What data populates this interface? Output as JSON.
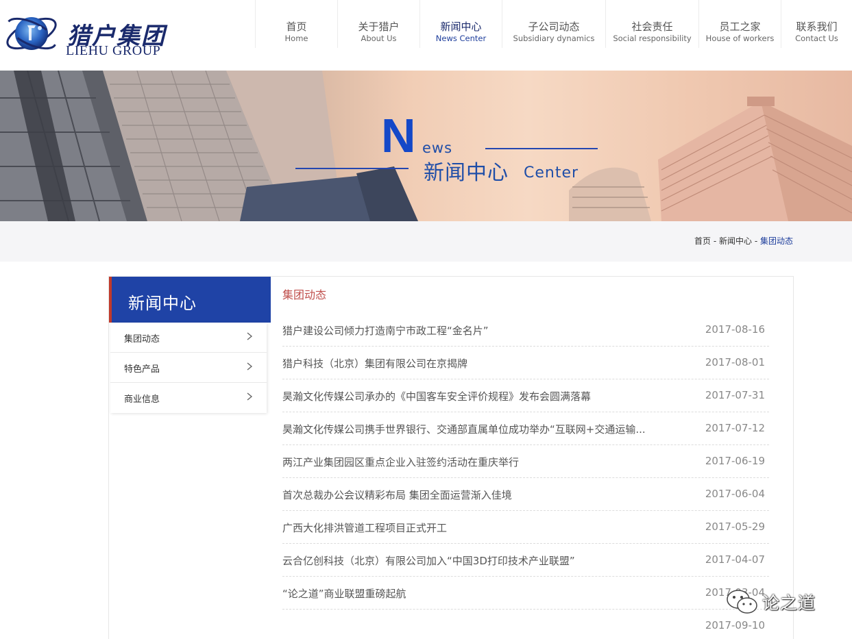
{
  "brand": {
    "name_cn": "猎户集团",
    "name_en": "LIEHU GROUP"
  },
  "nav": {
    "items": [
      {
        "cn": "首页",
        "en": "Home"
      },
      {
        "cn": "关于猎户",
        "en": "About Us"
      },
      {
        "cn": "新闻中心",
        "en": "News Center"
      },
      {
        "cn": "子公司动态",
        "en": "Subsidiary dynamics"
      },
      {
        "cn": "社会责任",
        "en": "Social responsibility"
      },
      {
        "cn": "员工之家",
        "en": "House of workers"
      },
      {
        "cn": "联系我们",
        "en": "Contact Us"
      }
    ],
    "active_index": 2
  },
  "banner": {
    "big_letter": "N",
    "rest_word": "ews",
    "title_cn": "新闻中心",
    "word_center": "Center"
  },
  "breadcrumb": {
    "home": "首页",
    "sep": " - ",
    "section": "新闻中心",
    "current": "集团动态"
  },
  "sidebar": {
    "title": "新闻中心",
    "items": [
      "集团动态",
      "特色产品",
      "商业信息"
    ]
  },
  "main": {
    "section_title": "集团动态",
    "news": [
      {
        "title": "猎户建设公司倾力打造南宁市政工程“金名片”",
        "date": "2017-08-16"
      },
      {
        "title": "猎户科技（北京）集团有限公司在京揭牌",
        "date": "2017-08-01"
      },
      {
        "title": "昊瀚文化传媒公司承办的《中国客车安全评价规程》发布会圆满落幕",
        "date": "2017-07-31"
      },
      {
        "title": "昊瀚文化传媒公司携手世界银行、交通部直属单位成功举办“互联网+交通运输...",
        "date": "2017-07-12"
      },
      {
        "title": "两江产业集团园区重点企业入驻签约活动在重庆举行",
        "date": "2017-06-19"
      },
      {
        "title": "首次总裁办公会议精彩布局 集团全面运营渐入佳境",
        "date": "2017-06-04"
      },
      {
        "title": "广西大化排洪管道工程项目正式开工",
        "date": "2017-05-29"
      },
      {
        "title": "云合亿创科技（北京）有限公司加入“中国3D打印技术产业联盟”",
        "date": "2017-04-07"
      },
      {
        "title": "“论之道”商业联盟重磅起航",
        "date": "2017-03-04"
      },
      {
        "title": "",
        "date": "2017-09-10"
      }
    ]
  },
  "watermark": {
    "text": "论之道"
  },
  "colors": {
    "brand_blue": "#1f43a6",
    "accent_red": "#c0392b",
    "section_red": "#c0504d"
  }
}
